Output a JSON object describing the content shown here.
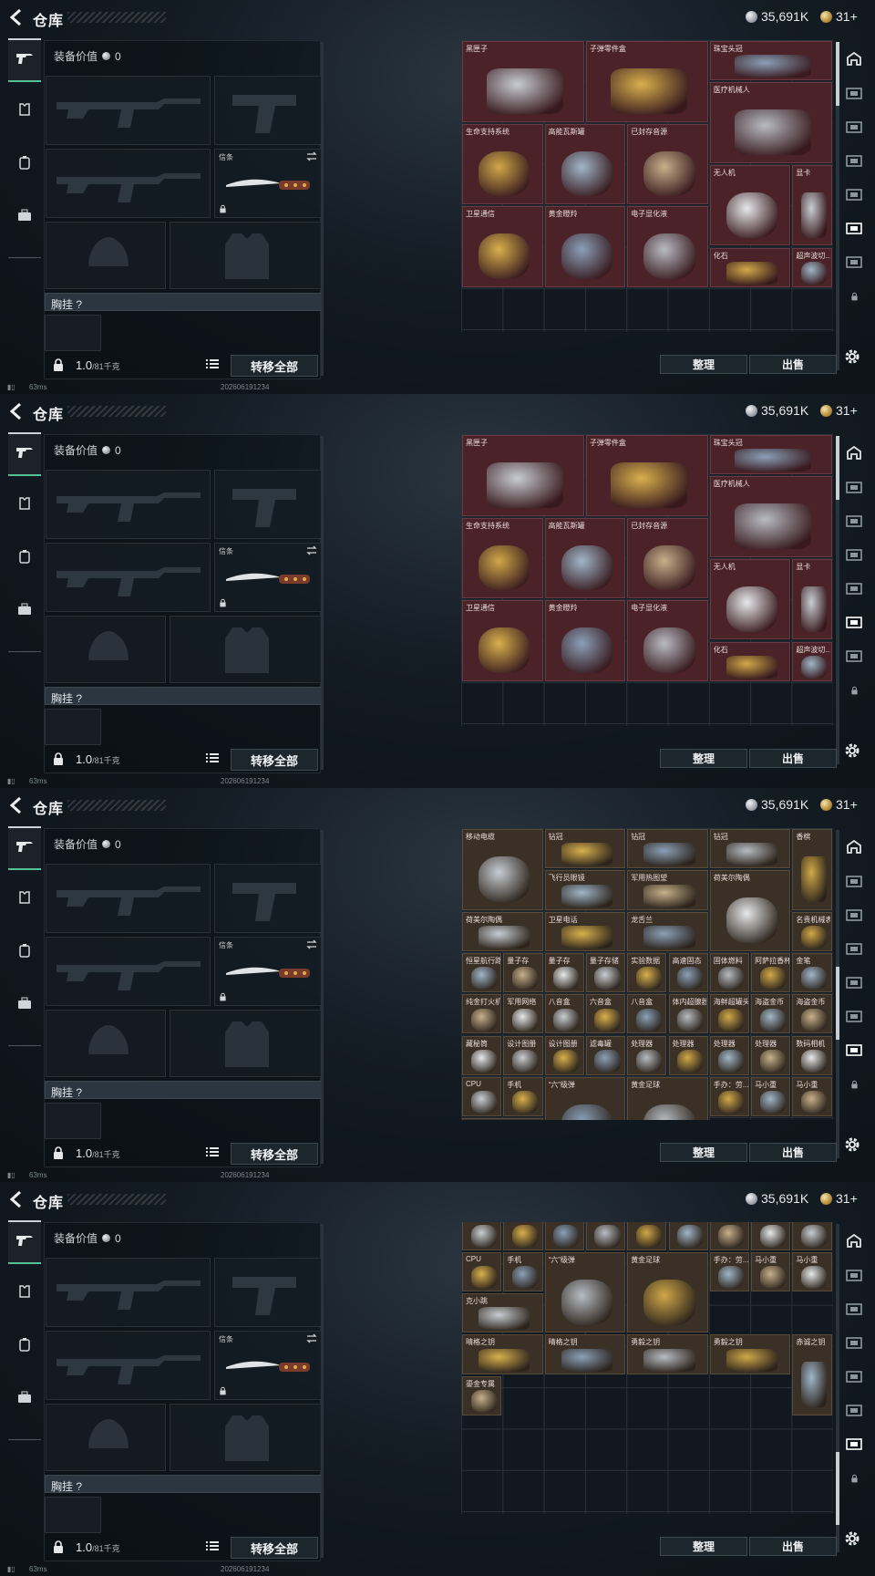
{
  "header": {
    "title": "仓库",
    "silver": "35,691K",
    "gold": "31+"
  },
  "equipment": {
    "value_label": "装备价值",
    "value": "0",
    "knife_tag": "信条",
    "vest_label": "胸挂 ?",
    "weight": "1.0",
    "weight_max": "/81千克",
    "transfer_all": "转移全部"
  },
  "actions": {
    "sort": "整理",
    "sell": "出售"
  },
  "footer": {
    "ping": "63ms",
    "timestamp": "202606191234"
  },
  "panels": [
    {
      "items": [
        "黑匣子",
        "子弹零件盒",
        "珠宝头冠",
        "医疗机械人",
        "生命支持系统",
        "高能瓦斯罐",
        "已封存音源",
        "无人机",
        "显卡",
        "卫星通信",
        "黄金瞪羚",
        "电子显化液",
        "化石",
        "超声波切..."
      ]
    },
    {
      "items": [
        "黑匣子",
        "子弹零件盒",
        "珠宝头冠",
        "医疗机械人",
        "生命支持系统",
        "高能瓦斯罐",
        "已封存音源",
        "无人机",
        "显卡",
        "卫星通信",
        "黄金瞪羚",
        "电子显化液",
        "化石",
        "超声波切..."
      ]
    },
    {
      "items": [
        "移动电缆",
        "钻冠",
        "钻冠",
        "钻冠",
        "香槟",
        "飞行员眼镜",
        "军用热图望",
        "荷美尔陶偶",
        "荷美尔陶偶",
        "卫星电话",
        "龙舌兰",
        "怀表",
        "名贵机械表",
        "恒星航行路",
        "量子存",
        "量子存",
        "量子存储",
        "实验数据",
        "高速固态",
        "固体燃料",
        "阿萨拉香杯",
        "金笔",
        "纯金打火机",
        "军用网络",
        "八音盒",
        "六音盒",
        "八音盒",
        "体内超腺器",
        "海鲜超罐头",
        "海盗金币",
        "海盗金币",
        "藏秘筒",
        "设计图册",
        "设计图册",
        "滤毒罐",
        "处理器",
        "处理器",
        "处理器",
        "处理器",
        "数码相机",
        "CPU",
        "手机",
        "“六”级弹",
        "黄金足球",
        "手办：劳...",
        "马小重",
        "马小重",
        "克小跳"
      ]
    },
    {
      "items": [
        "藏秘筒",
        "设计图册",
        "设计图册",
        "滤毒罐",
        "处理器",
        "处理器",
        "处理器",
        "处理器",
        "数码相机",
        "CPU",
        "手机",
        "“六”级弹",
        "黄金足球",
        "手办：劳...",
        "马小重",
        "马小重",
        "克小跳",
        "晴格之钥",
        "晴格之钥",
        "勇毅之钥",
        "勇毅之钥",
        "赤诚之钥",
        "鎏金专属"
      ]
    }
  ],
  "colors": {
    "item_red": "#4a2228",
    "item_brown": "#3b3026",
    "accent_green": "#55c296"
  },
  "icons": [
    "back-arrow-icon",
    "pistol-icon",
    "armor-icon",
    "backpack-icon",
    "briefcase-icon",
    "lock-icon",
    "list-icon",
    "gear-icon",
    "swap-icon",
    "silver-coin-icon",
    "gold-coin-icon"
  ]
}
